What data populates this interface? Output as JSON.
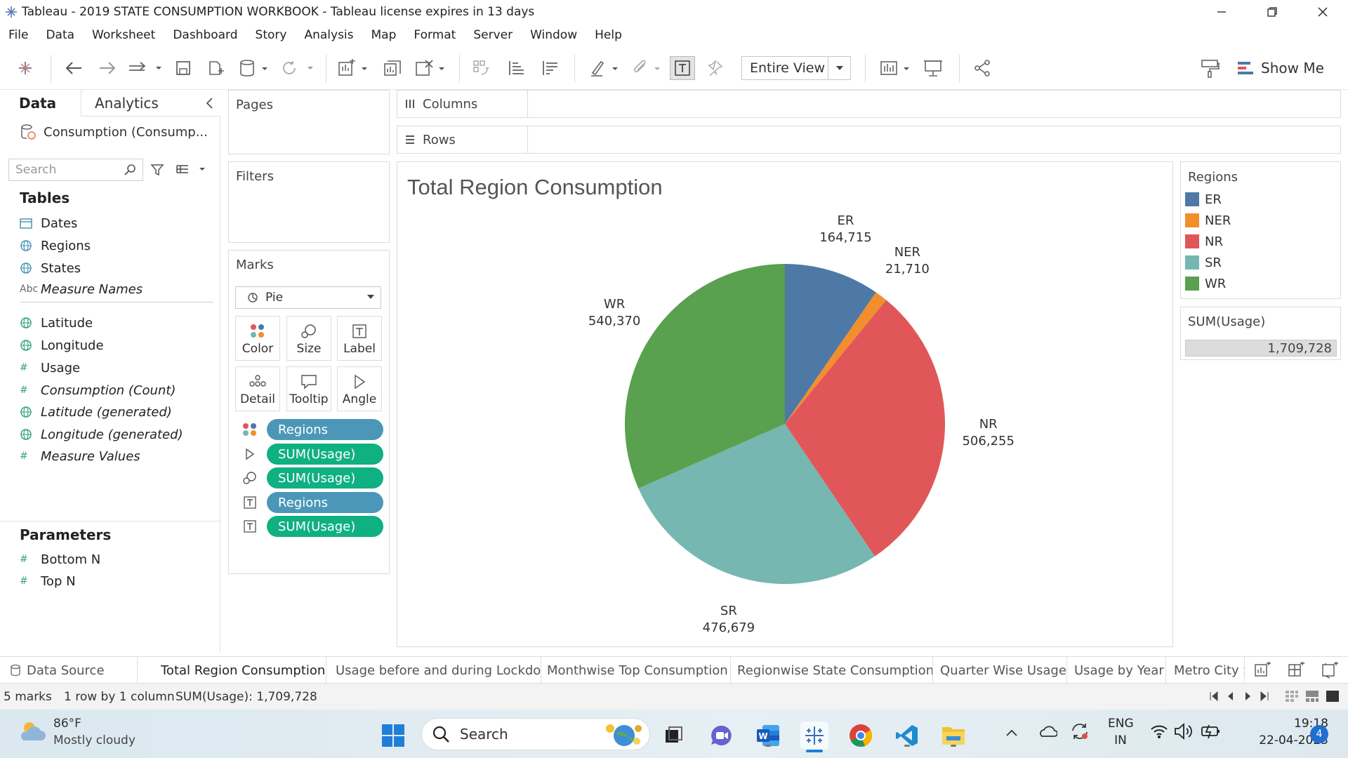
{
  "window": {
    "title": "Tableau - 2019 STATE CONSUMPTION WORKBOOK - Tableau license expires in 13 days"
  },
  "menu": [
    "File",
    "Data",
    "Worksheet",
    "Dashboard",
    "Story",
    "Analysis",
    "Map",
    "Format",
    "Server",
    "Window",
    "Help"
  ],
  "toolbar": {
    "view_mode": "Entire View",
    "show_me_label": "Show Me"
  },
  "data_pane": {
    "tab_data": "Data",
    "tab_analytics": "Analytics",
    "data_source": "Consumption (Consump...",
    "search_placeholder": "Search",
    "tables_title": "Tables",
    "fields": [
      {
        "label": "Dates",
        "icon": "calendar-icon",
        "italic": false
      },
      {
        "label": "Regions",
        "icon": "globe-icon",
        "italic": false
      },
      {
        "label": "States",
        "icon": "globe-icon",
        "italic": false
      },
      {
        "label": "Measure Names",
        "icon": "abc-icon",
        "italic": true
      },
      {
        "label": "Latitude",
        "icon": "globe-icon",
        "italic": false
      },
      {
        "label": "Longitude",
        "icon": "globe-icon",
        "italic": false
      },
      {
        "label": "Usage",
        "icon": "hash-icon",
        "italic": false
      },
      {
        "label": "Consumption (Count)",
        "icon": "hash-icon",
        "italic": true
      },
      {
        "label": "Latitude (generated)",
        "icon": "globe-icon",
        "italic": true
      },
      {
        "label": "Longitude (generated)",
        "icon": "globe-icon",
        "italic": true
      },
      {
        "label": "Measure Values",
        "icon": "hash-icon",
        "italic": true
      }
    ],
    "parameters_title": "Parameters",
    "parameters": [
      {
        "label": "Bottom N",
        "icon": "hash-icon"
      },
      {
        "label": "Top N",
        "icon": "hash-icon"
      }
    ]
  },
  "shelves": {
    "pages": "Pages",
    "filters": "Filters",
    "columns": "Columns",
    "rows": "Rows"
  },
  "marks": {
    "title": "Marks",
    "type": "Pie",
    "buttons": [
      "Color",
      "Size",
      "Label",
      "Detail",
      "Tooltip",
      "Angle"
    ],
    "pills": [
      {
        "label": "Regions",
        "kind": "dimension",
        "icon": "color-icon"
      },
      {
        "label": "SUM(Usage)",
        "kind": "measure",
        "icon": "angle-icon"
      },
      {
        "label": "SUM(Usage)",
        "kind": "measure",
        "icon": "size-icon"
      },
      {
        "label": "Regions",
        "kind": "dimension",
        "icon": "label-icon"
      },
      {
        "label": "SUM(Usage)",
        "kind": "measure",
        "icon": "label-icon"
      }
    ]
  },
  "chart_data": {
    "type": "pie",
    "title": "Total Region Consumption",
    "categories": [
      "ER",
      "NER",
      "NR",
      "SR",
      "WR"
    ],
    "values": [
      164715,
      21710,
      506255,
      476679,
      540370
    ],
    "value_labels": [
      "164,715",
      "21,710",
      "506,255",
      "476,679",
      "540,370"
    ],
    "colors": [
      "#4e79a7",
      "#f28e2b",
      "#e15759",
      "#76b7b2",
      "#59a14f"
    ],
    "legend_title": "Regions",
    "legend_position": "right"
  },
  "size_legend": {
    "title": "SUM(Usage)",
    "value": "1,709,728"
  },
  "sheet_tabs": {
    "data_source": "Data Source",
    "sheets": [
      {
        "label": "Total Region Consumption",
        "active": true
      },
      {
        "label": "Usage before and during Lockdo...",
        "active": false
      },
      {
        "label": "Monthwise Top Consumption",
        "active": false
      },
      {
        "label": "Regionwise State Consumption",
        "active": false
      },
      {
        "label": "Quarter Wise Usage",
        "active": false
      },
      {
        "label": "Usage by Year",
        "active": false
      },
      {
        "label": "Metro City S",
        "active": false
      }
    ]
  },
  "status": {
    "marks": "5 marks",
    "dims": "1 row by 1 column",
    "sum": "SUM(Usage): 1,709,728"
  },
  "taskbar": {
    "weather_temp": "86°F",
    "weather_desc": "Mostly cloudy",
    "search_label": "Search",
    "lang_1": "ENG",
    "lang_2": "IN",
    "time": "19:18",
    "date": "22-04-2023",
    "notifications": "4"
  }
}
